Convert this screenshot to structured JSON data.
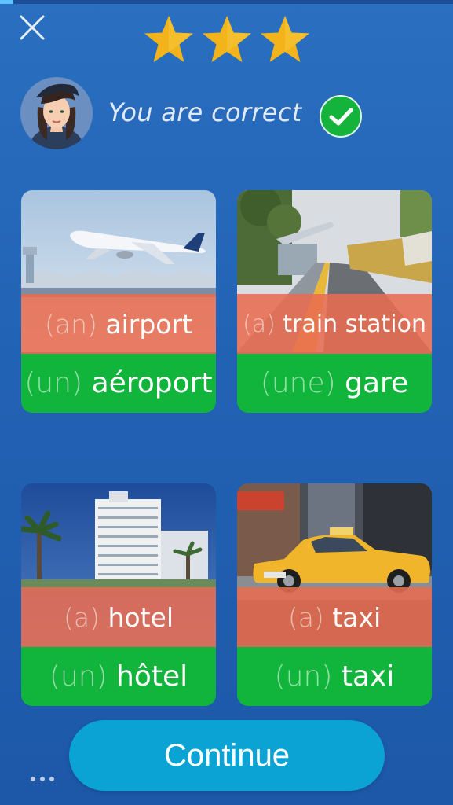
{
  "progress": {
    "fraction": 0.03
  },
  "header": {
    "close_icon": "close-icon",
    "stars_earned": 3,
    "stars_total": 3,
    "star_color": "#f3b31b"
  },
  "feedback": {
    "text": "You are correct",
    "check_color": "#14b43c"
  },
  "cards": [
    {
      "photo": "airplane-photo",
      "en_article": "(an)",
      "en_word": "airport",
      "fr_article": "(un)",
      "fr_word": "aéroport"
    },
    {
      "photo": "train-station-photo",
      "en_article": "(a)",
      "en_word": "train station",
      "fr_article": "(une)",
      "fr_word": "gare"
    },
    {
      "photo": "hotel-photo",
      "en_article": "(a)",
      "en_word": "hotel",
      "fr_article": "(un)",
      "fr_word": "hôtel"
    },
    {
      "photo": "taxi-photo",
      "en_article": "(a)",
      "en_word": "taxi",
      "fr_article": "(un)",
      "fr_word": "taxi"
    }
  ],
  "continue_label": "Continue",
  "colors": {
    "background": "#2262b4",
    "english_band": "#e86c50",
    "french_band": "#12b53c",
    "continue_button": "#0aa3d4"
  }
}
